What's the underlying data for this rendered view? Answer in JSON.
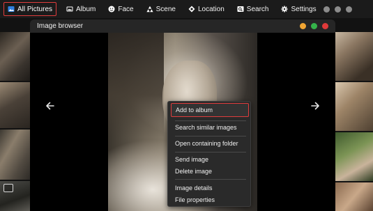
{
  "nav": {
    "items": [
      {
        "label": "All Pictures",
        "icon": "picture-icon",
        "active": true
      },
      {
        "label": "Album",
        "icon": "album-icon"
      },
      {
        "label": "Face",
        "icon": "face-icon"
      },
      {
        "label": "Scene",
        "icon": "scene-icon"
      },
      {
        "label": "Location",
        "icon": "location-icon"
      },
      {
        "label": "Search",
        "icon": "search-icon"
      },
      {
        "label": "Settings",
        "icon": "gear-icon"
      }
    ],
    "highlight_color": "#e03c3c"
  },
  "browser": {
    "title": "Image browser",
    "window_button_colors": [
      "#f1a533",
      "#35b34a",
      "#e03a3a"
    ]
  },
  "context_menu": {
    "items": [
      {
        "label": "Add to album",
        "highlighted": true
      },
      {
        "label": "Search similar images"
      },
      {
        "label": "Open containing folder"
      },
      {
        "label": "Send image"
      },
      {
        "label": "Delete image"
      },
      {
        "label": "Image details"
      },
      {
        "label": "File properties"
      }
    ]
  },
  "icons": {
    "prev": "chevron-left-icon",
    "next": "chevron-right-icon"
  }
}
